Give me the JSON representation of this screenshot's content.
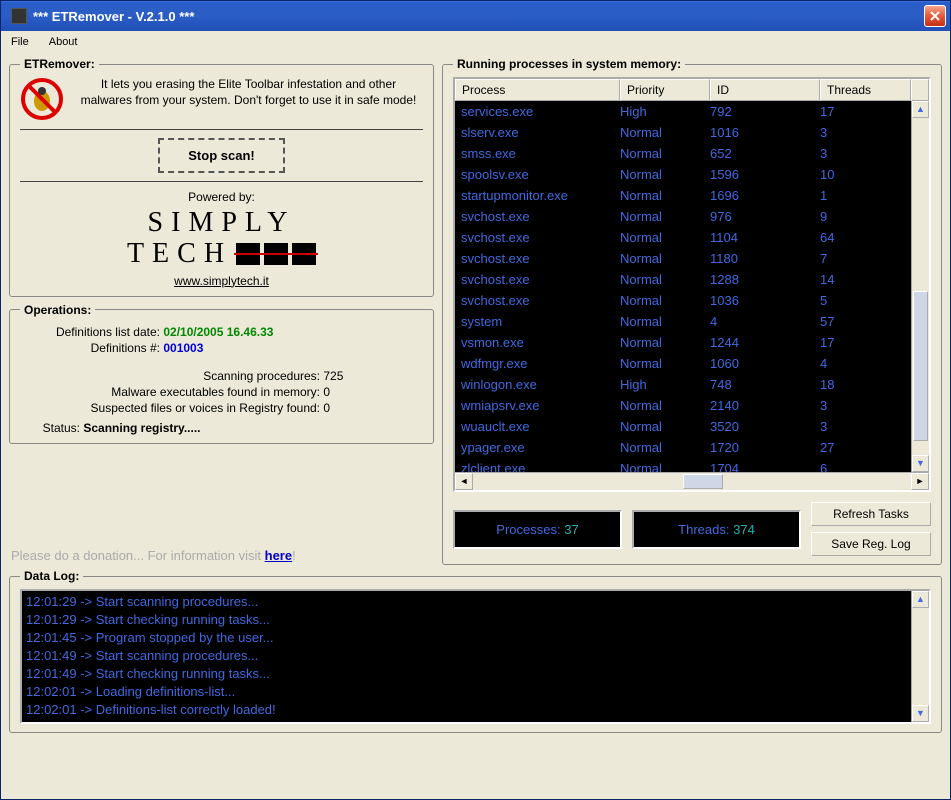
{
  "window": {
    "title": "*** ETRemover - V.2.1.0 ***"
  },
  "menu": {
    "file": "File",
    "about": "About"
  },
  "etremover": {
    "legend": "ETRemover:",
    "intro": "It lets you erasing the Elite Toolbar infestation and other malwares from your system. Don't forget to use it in safe mode!",
    "stop_btn": "Stop scan!",
    "powered_by": "Powered by:",
    "logo_line1": "SIMPLY",
    "logo_line2": "TECH",
    "logo_url": "www.simplytech.it"
  },
  "operations": {
    "legend": "Operations:",
    "def_date_label": "Definitions list date:",
    "def_date_value": "02/10/2005 16.46.33",
    "def_num_label": "Definitions #:",
    "def_num_value": "001003",
    "scanning_label": "Scanning procedures:",
    "scanning_value": "725",
    "malware_label": "Malware executables found in memory:",
    "malware_value": "0",
    "registry_label": "Suspected files or voices in Registry found:",
    "registry_value": "0",
    "status_label": "Status:",
    "status_value": "Scanning registry....."
  },
  "donation": {
    "text": "Please do a donation... For information visit ",
    "link": "here"
  },
  "processes": {
    "legend": "Running processes in system memory:",
    "headers": {
      "process": "Process",
      "priority": "Priority",
      "id": "ID",
      "threads": "Threads"
    },
    "rows": [
      {
        "process": "services.exe",
        "priority": "High",
        "id": "792",
        "threads": "17"
      },
      {
        "process": "slserv.exe",
        "priority": "Normal",
        "id": "1016",
        "threads": "3"
      },
      {
        "process": "smss.exe",
        "priority": "Normal",
        "id": "652",
        "threads": "3"
      },
      {
        "process": "spoolsv.exe",
        "priority": "Normal",
        "id": "1596",
        "threads": "10"
      },
      {
        "process": "startupmonitor.exe",
        "priority": "Normal",
        "id": "1696",
        "threads": "1"
      },
      {
        "process": "svchost.exe",
        "priority": "Normal",
        "id": "976",
        "threads": "9"
      },
      {
        "process": "svchost.exe",
        "priority": "Normal",
        "id": "1104",
        "threads": "64"
      },
      {
        "process": "svchost.exe",
        "priority": "Normal",
        "id": "1180",
        "threads": "7"
      },
      {
        "process": "svchost.exe",
        "priority": "Normal",
        "id": "1288",
        "threads": "14"
      },
      {
        "process": "svchost.exe",
        "priority": "Normal",
        "id": "1036",
        "threads": "5"
      },
      {
        "process": "system",
        "priority": "Normal",
        "id": "4",
        "threads": "57"
      },
      {
        "process": "vsmon.exe",
        "priority": "Normal",
        "id": "1244",
        "threads": "17"
      },
      {
        "process": "wdfmgr.exe",
        "priority": "Normal",
        "id": "1060",
        "threads": "4"
      },
      {
        "process": "winlogon.exe",
        "priority": "High",
        "id": "748",
        "threads": "18"
      },
      {
        "process": "wmiapsrv.exe",
        "priority": "Normal",
        "id": "2140",
        "threads": "3"
      },
      {
        "process": "wuauclt.exe",
        "priority": "Normal",
        "id": "3520",
        "threads": "3"
      },
      {
        "process": "ypager.exe",
        "priority": "Normal",
        "id": "1720",
        "threads": "27"
      },
      {
        "process": "zlclient.exe",
        "priority": "Normal",
        "id": "1704",
        "threads": "6"
      }
    ],
    "processes_label": "Processes:",
    "processes_count": "37",
    "threads_label": "Threads:",
    "threads_count": "374",
    "refresh_btn": "Refresh Tasks",
    "save_btn": "Save Reg. Log"
  },
  "datalog": {
    "legend": "Data Log:",
    "lines": [
      "12:01:29 -> Start scanning procedures...",
      "12:01:29 -> Start checking running tasks...",
      "12:01:45 -> Program stopped by the user...",
      "12:01:49 -> Start scanning procedures...",
      "12:01:49 -> Start checking running tasks...",
      "12:02:01 -> Loading definitions-list...",
      "12:02:01 -> Definitions-list correctly loaded!"
    ]
  }
}
